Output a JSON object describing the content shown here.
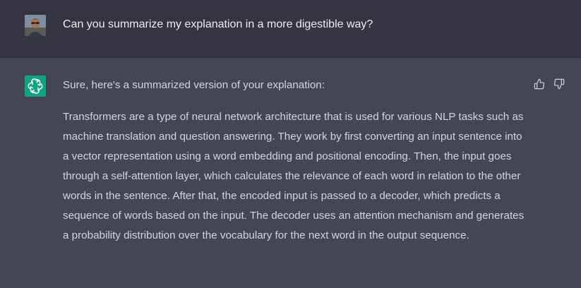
{
  "user_message": {
    "text": "Can you summarize my explanation in a more digestible way?"
  },
  "assistant_message": {
    "intro": "Sure, here's a summarized version of your explanation:",
    "body": "Transformers are a type of neural network architecture that is used for various NLP tasks such as machine translation and question answering. They work by first converting an input sentence into a vector representation using a word embedding and positional encoding. Then, the input goes through a self-attention layer, which calculates the relevance of each word in relation to the other words in the sentence. After that, the encoded input is passed to a decoder, which predicts a sequence of words based on the input. The decoder uses an attention mechanism and generates a probability distribution over the vocabulary for the next word in the output sequence."
  },
  "feedback": {
    "thumbs_up_icon": "thumbs-up-icon",
    "thumbs_down_icon": "thumbs-down-icon"
  },
  "colors": {
    "user_bg": "#343541",
    "assistant_bg": "#444654",
    "brand": "#10a37f",
    "text": "#d1d5db"
  }
}
